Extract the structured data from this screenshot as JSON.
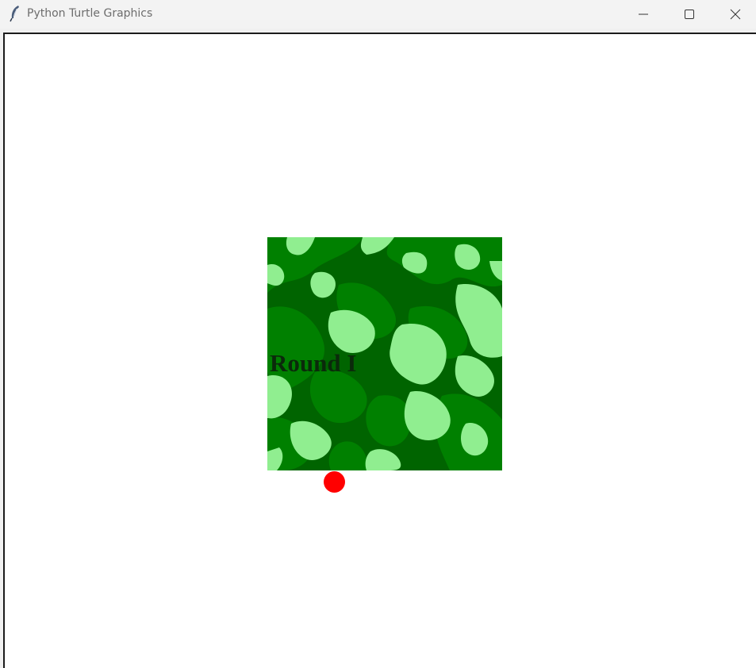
{
  "window": {
    "title": "Python Turtle Graphics",
    "icon": "feather-icon",
    "controls": {
      "minimize_icon": "minimize-icon",
      "maximize_icon": "maximize-icon",
      "close_icon": "close-icon"
    }
  },
  "canvas": {
    "background": "#ffffff",
    "camo_colors": {
      "dark": "#006400",
      "mid": "#008000",
      "light": "#90ee90"
    },
    "round_label": "Round I",
    "dot_color": "#ff0000"
  }
}
